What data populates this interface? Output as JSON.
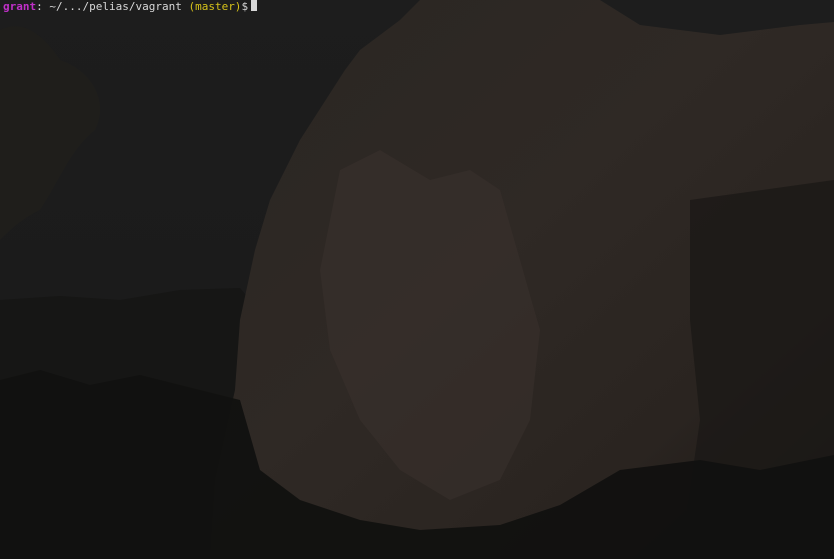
{
  "terminal": {
    "prompt": {
      "user": "grant",
      "separator": ":",
      "path": "~/.../pelias/vagrant",
      "branch": "(master)",
      "symbol": "$"
    }
  },
  "colors": {
    "user": "#c030c8",
    "branch": "#d6c21a",
    "text": "#d8d8d8",
    "background": "#141414"
  },
  "background_image": "el-capitan-cliff-wallpaper"
}
